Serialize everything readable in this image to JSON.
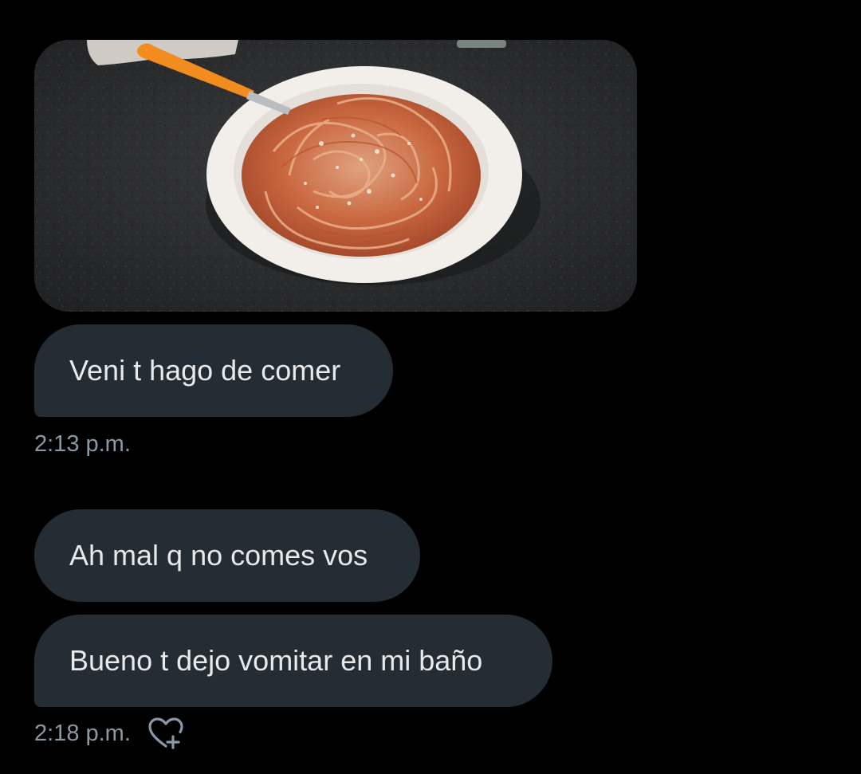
{
  "messages": [
    {
      "type": "image",
      "image_alt": "plato de espaguetis con salsa de tomate y queso rallado"
    },
    {
      "type": "text",
      "text": "Veni t hago de comer"
    },
    {
      "type": "text",
      "text": "Ah mal q no comes vos"
    },
    {
      "type": "text",
      "text": "Bueno t dejo vomitar en mi baño"
    }
  ],
  "timestamps": {
    "first": "2:13 p.m.",
    "second": "2:18 p.m."
  },
  "icons": {
    "reaction": "heart-plus-icon"
  },
  "colors": {
    "background": "#000000",
    "bubble": "#242c34",
    "text": "#e7e9ea",
    "muted": "#8b98a5"
  }
}
